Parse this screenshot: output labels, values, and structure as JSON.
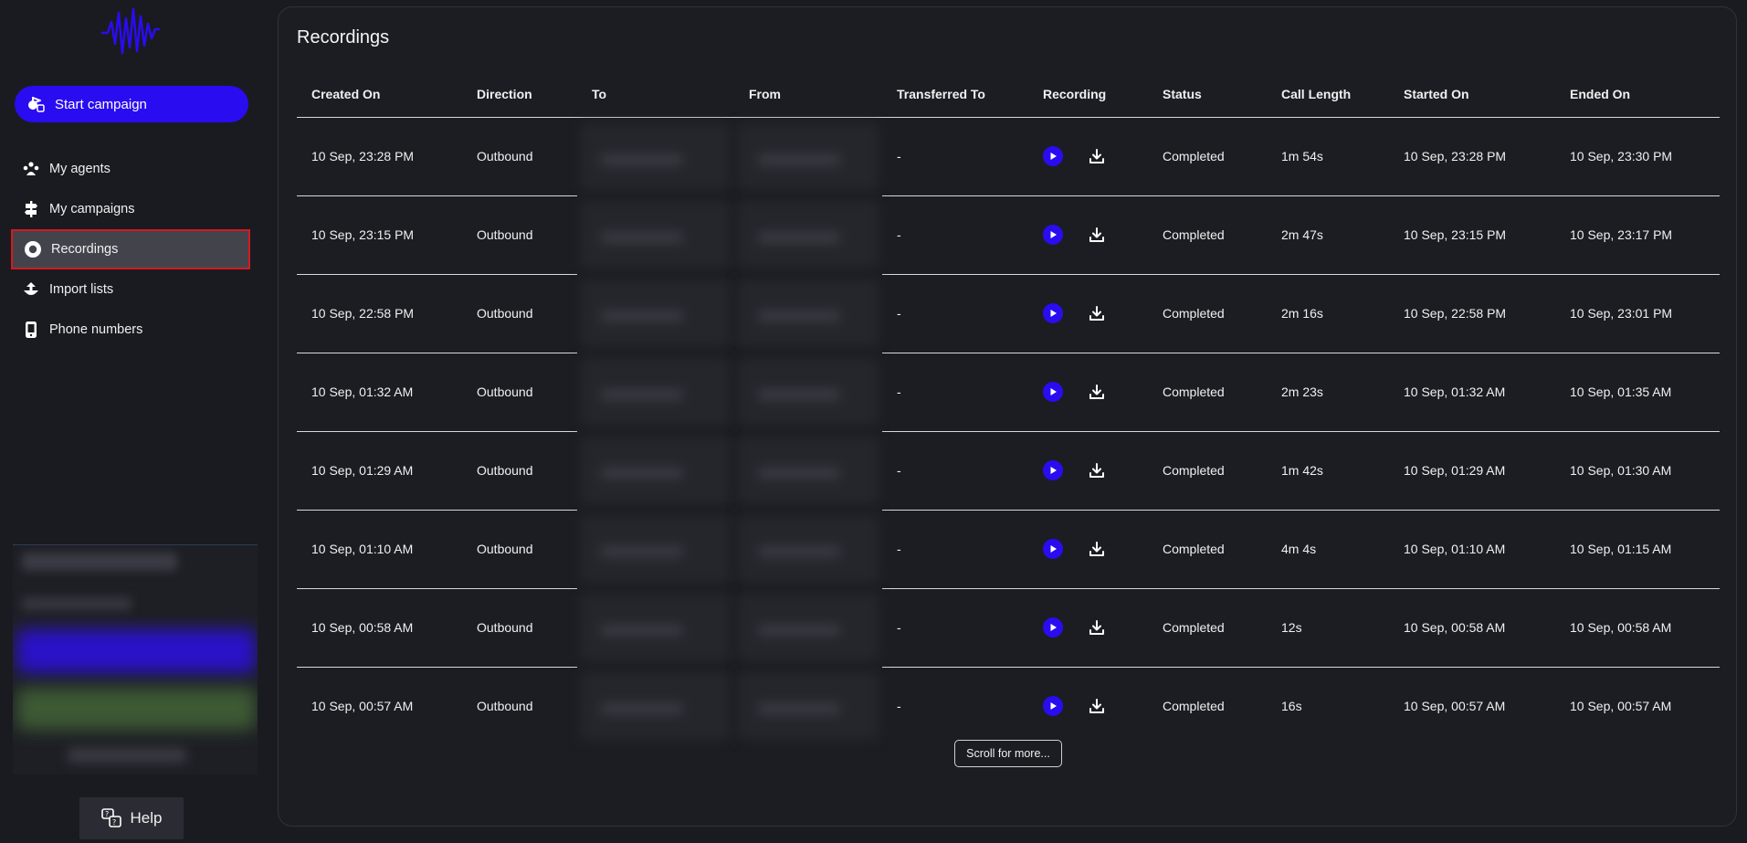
{
  "sidebar": {
    "start_campaign": "Start campaign",
    "items": [
      {
        "label": "My agents",
        "icon": "agents-icon"
      },
      {
        "label": "My campaigns",
        "icon": "signpost-icon"
      },
      {
        "label": "Recordings",
        "icon": "record-icon"
      },
      {
        "label": "Import lists",
        "icon": "upload-icon"
      },
      {
        "label": "Phone numbers",
        "icon": "phone-icon"
      }
    ],
    "help": "Help"
  },
  "main": {
    "title": "Recordings",
    "columns": [
      "Created On",
      "Direction",
      "To",
      "From",
      "Transferred To",
      "Recording",
      "Status",
      "Call Length",
      "Started On",
      "Ended On"
    ],
    "rows": [
      {
        "created": "10 Sep, 23:28 PM",
        "direction": "Outbound",
        "transferred": "-",
        "status": "Completed",
        "length": "1m 54s",
        "started": "10 Sep, 23:28 PM",
        "ended": "10 Sep, 23:30 PM"
      },
      {
        "created": "10 Sep, 23:15 PM",
        "direction": "Outbound",
        "transferred": "-",
        "status": "Completed",
        "length": "2m 47s",
        "started": "10 Sep, 23:15 PM",
        "ended": "10 Sep, 23:17 PM"
      },
      {
        "created": "10 Sep, 22:58 PM",
        "direction": "Outbound",
        "transferred": "-",
        "status": "Completed",
        "length": "2m 16s",
        "started": "10 Sep, 22:58 PM",
        "ended": "10 Sep, 23:01 PM"
      },
      {
        "created": "10 Sep, 01:32 AM",
        "direction": "Outbound",
        "transferred": "-",
        "status": "Completed",
        "length": "2m 23s",
        "started": "10 Sep, 01:32 AM",
        "ended": "10 Sep, 01:35 AM"
      },
      {
        "created": "10 Sep, 01:29 AM",
        "direction": "Outbound",
        "transferred": "-",
        "status": "Completed",
        "length": "1m 42s",
        "started": "10 Sep, 01:29 AM",
        "ended": "10 Sep, 01:30 AM"
      },
      {
        "created": "10 Sep, 01:10 AM",
        "direction": "Outbound",
        "transferred": "-",
        "status": "Completed",
        "length": "4m 4s",
        "started": "10 Sep, 01:10 AM",
        "ended": "10 Sep, 01:15 AM"
      },
      {
        "created": "10 Sep, 00:58 AM",
        "direction": "Outbound",
        "transferred": "-",
        "status": "Completed",
        "length": "12s",
        "started": "10 Sep, 00:58 AM",
        "ended": "10 Sep, 00:58 AM"
      },
      {
        "created": "10 Sep, 00:57 AM",
        "direction": "Outbound",
        "transferred": "-",
        "status": "Completed",
        "length": "16s",
        "started": "10 Sep, 00:57 AM",
        "ended": "10 Sep, 00:57 AM"
      }
    ],
    "scroll_more": "Scroll for more..."
  },
  "colors": {
    "accent": "#2a0cf0",
    "background": "#1a1b20",
    "active_outline": "#d41920"
  }
}
